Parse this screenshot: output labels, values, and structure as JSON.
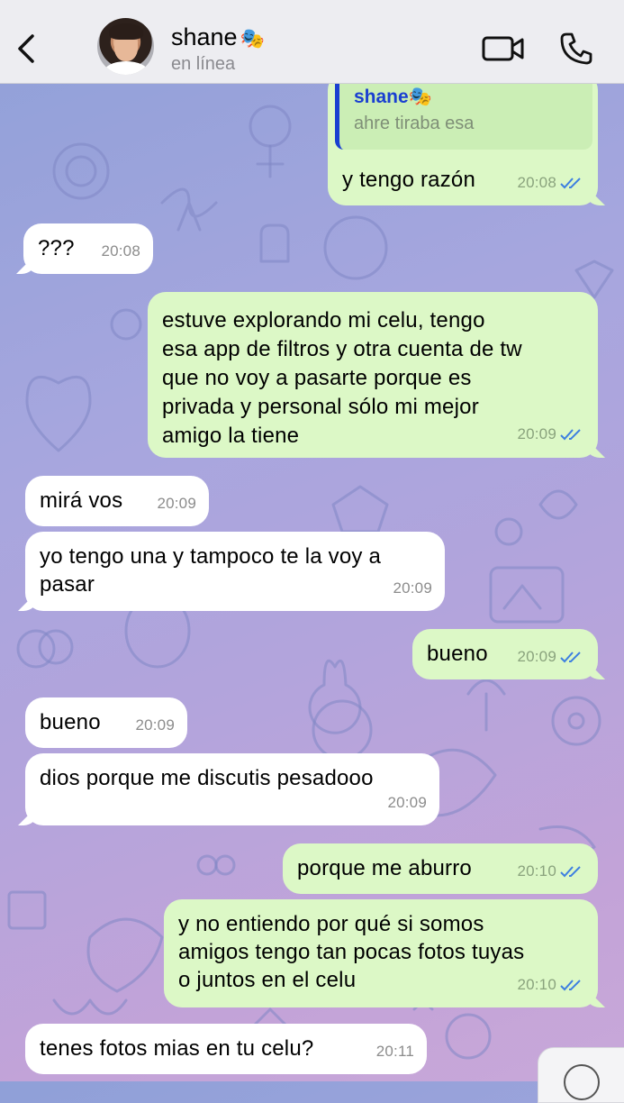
{
  "header": {
    "contact_name": "shane",
    "contact_emoji": "🎭",
    "status": "en línea",
    "back_icon": "chevron-left-icon",
    "video_icon": "video-camera-icon",
    "call_icon": "phone-icon"
  },
  "reply_quote": {
    "name": "shane🎭",
    "text": "ahre tiraba esa"
  },
  "messages": [
    {
      "dir": "out",
      "text": "y tengo razón",
      "time": "20:08"
    },
    {
      "dir": "in",
      "text": "???",
      "time": "20:08"
    },
    {
      "dir": "out",
      "text": "estuve explorando mi celu, tengo\nesa app de filtros y otra cuenta de tw\nque no voy a pasarte porque es\nprivada y personal sólo mi mejor\namigo la tiene",
      "time": "20:09"
    },
    {
      "dir": "in",
      "text": "mirá vos",
      "time": "20:09"
    },
    {
      "dir": "in",
      "text": "yo tengo una y tampoco te la voy a\npasar",
      "time": "20:09"
    },
    {
      "dir": "out",
      "text": "bueno",
      "time": "20:09"
    },
    {
      "dir": "in",
      "text": "bueno",
      "time": "20:09"
    },
    {
      "dir": "in",
      "text": "dios porque me discutis pesadooo",
      "time": "20:09"
    },
    {
      "dir": "out",
      "text": "porque me aburro",
      "time": "20:10"
    },
    {
      "dir": "out",
      "text": "y no entiendo por qué si somos\namigos tengo tan pocas fotos tuyas\no juntos en el celu",
      "time": "20:10"
    },
    {
      "dir": "in",
      "text": "tenes fotos mias en tu celu?",
      "time": "20:11"
    }
  ],
  "colors": {
    "incoming": "#ffffff",
    "outgoing": "#dcf8c6",
    "read_ticks": "#3d7fe0",
    "quote_accent": "#1a3fd1"
  }
}
